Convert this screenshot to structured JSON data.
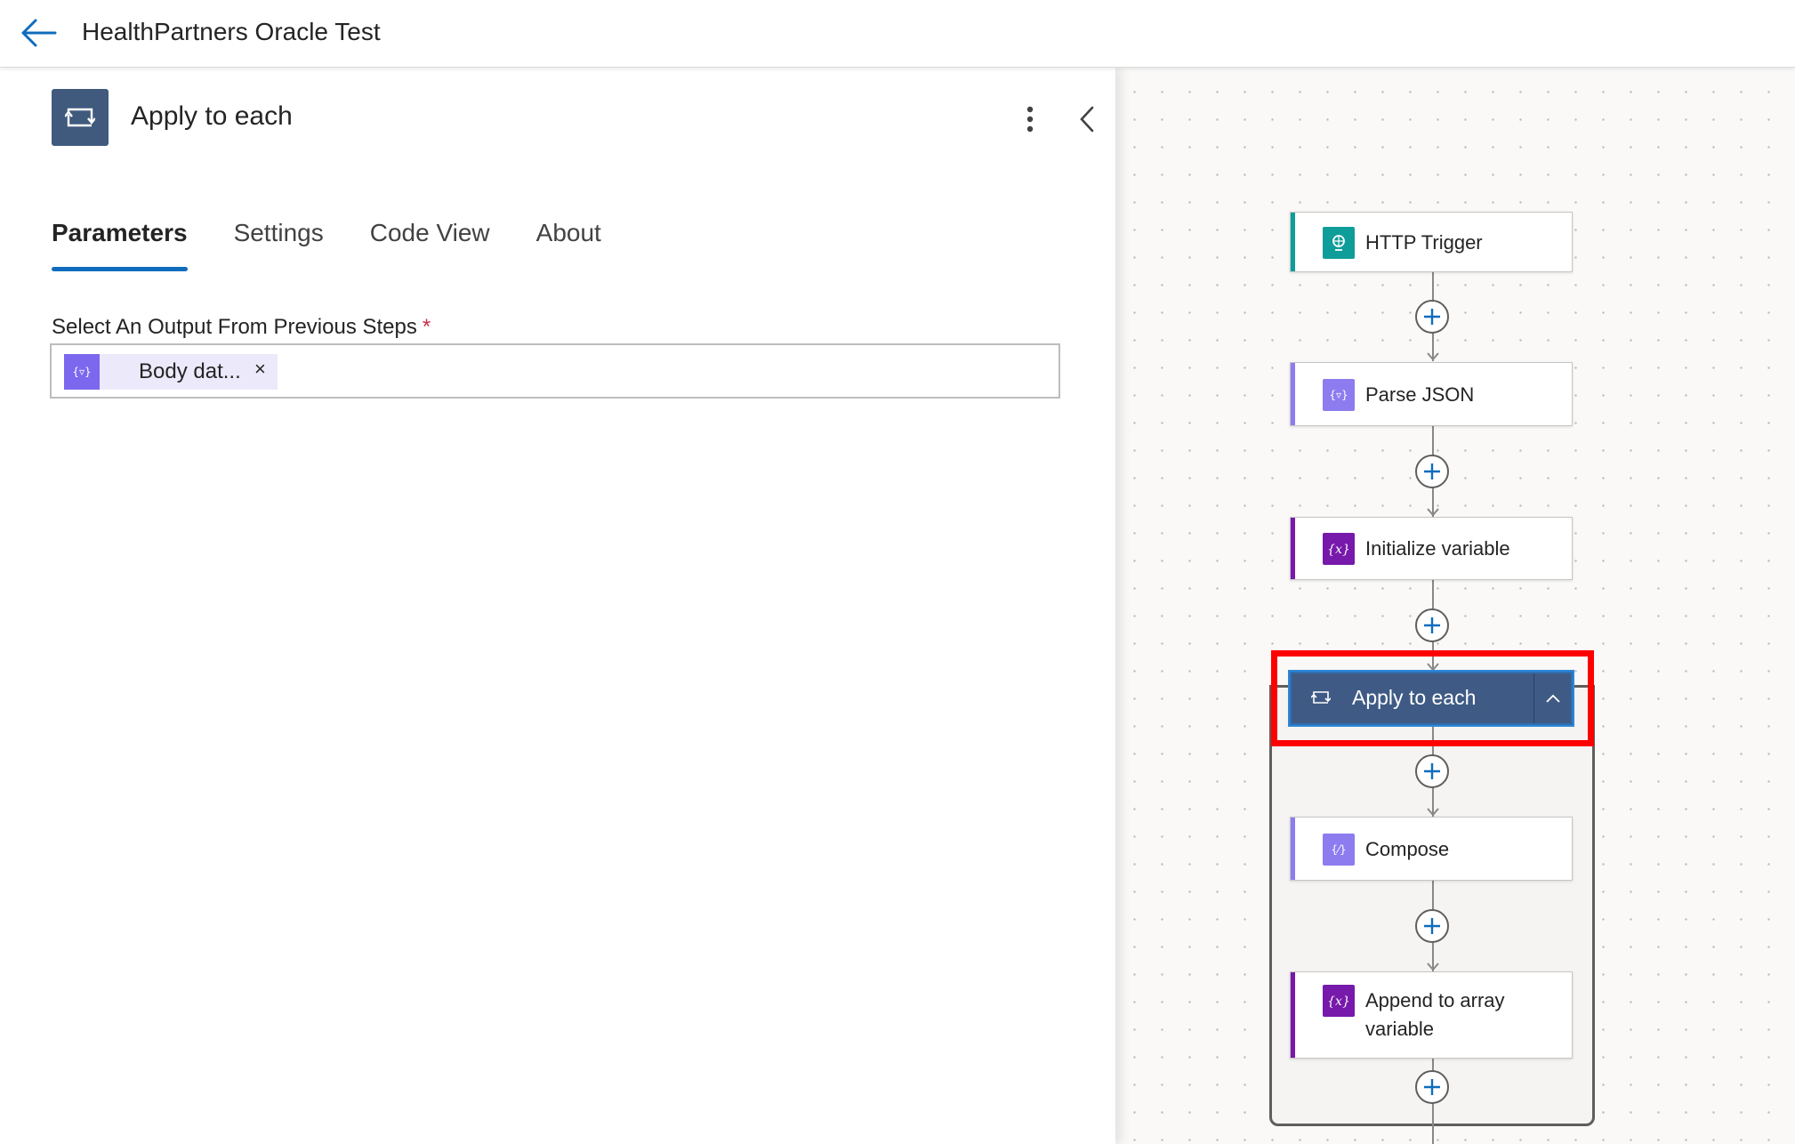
{
  "header": {
    "title": "HealthPartners Oracle Test"
  },
  "panel": {
    "title": "Apply to each",
    "tabs": [
      {
        "label": "Parameters",
        "active": true
      },
      {
        "label": "Settings",
        "active": false
      },
      {
        "label": "Code View",
        "active": false
      },
      {
        "label": "About",
        "active": false
      }
    ],
    "field": {
      "label": "Select An Output From Previous Steps",
      "required_mark": "*",
      "token_text": "Body dat...",
      "token_remove": "×"
    }
  },
  "flow": {
    "nodes": [
      {
        "label": "HTTP Trigger",
        "icon": "http-trigger-icon",
        "accent": "#0f9d9a"
      },
      {
        "label": "Parse JSON",
        "icon": "parse-json-icon",
        "accent": "#8c7cf0"
      },
      {
        "label": "Initialize variable",
        "icon": "variable-icon",
        "accent": "#7719aa"
      },
      {
        "label": "Apply to each",
        "icon": "loop-icon",
        "accent": "#3f5b85"
      },
      {
        "label": "Compose",
        "icon": "compose-icon",
        "accent": "#8c7cf0"
      },
      {
        "label": "Append to array variable",
        "icon": "variable-icon",
        "accent": "#7719aa"
      }
    ]
  },
  "colors": {
    "accent_blue": "#0f6cbd",
    "loop_header": "#3f5b85",
    "highlight": "#ff0000",
    "token_bg": "#ece9fb"
  }
}
